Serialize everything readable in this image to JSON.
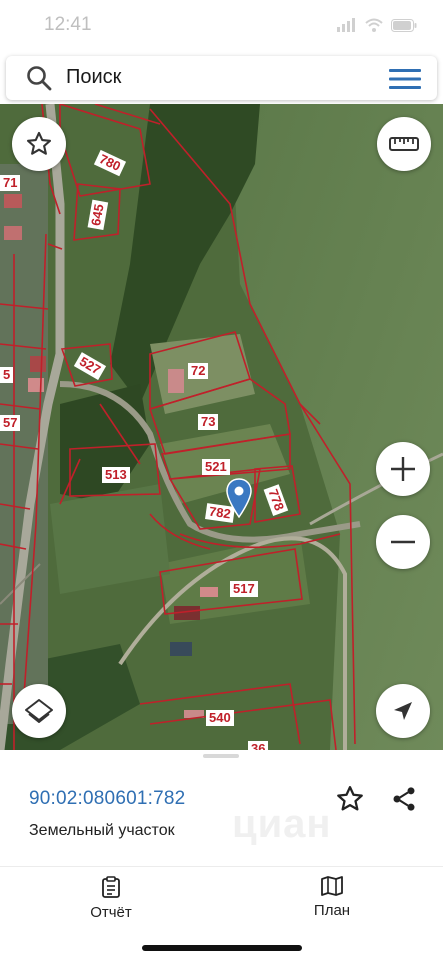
{
  "status_bar": {
    "time": "12:41"
  },
  "search": {
    "label": "Поиск"
  },
  "map": {
    "parcels": [
      {
        "id": "p780",
        "label": "780"
      },
      {
        "id": "p645",
        "label": "645"
      },
      {
        "id": "p71",
        "label": "71"
      },
      {
        "id": "p527",
        "label": "527"
      },
      {
        "id": "p72",
        "label": "72"
      },
      {
        "id": "p73",
        "label": "73"
      },
      {
        "id": "p513",
        "label": "513"
      },
      {
        "id": "p521",
        "label": "521"
      },
      {
        "id": "p782",
        "label": "782"
      },
      {
        "id": "p778",
        "label": "778"
      },
      {
        "id": "p517",
        "label": "517"
      },
      {
        "id": "p540",
        "label": "540"
      },
      {
        "id": "p5",
        "label": "5"
      },
      {
        "id": "p57",
        "label": "57"
      },
      {
        "id": "p36",
        "label": "36"
      }
    ]
  },
  "sheet": {
    "cadastral_number": "90:02:080601:782",
    "parcel_type": "Земельный участок",
    "watermark": "циан"
  },
  "tabs": [
    {
      "label": "Отчёт"
    },
    {
      "label": "План"
    }
  ],
  "colors": {
    "parcel_border": "#c0202a",
    "link_blue": "#2f6fb3",
    "menu_blue": "#2f6fb3"
  }
}
